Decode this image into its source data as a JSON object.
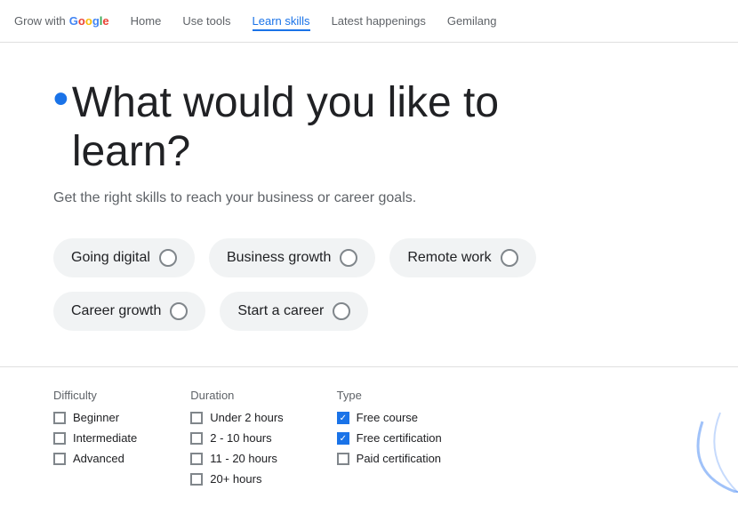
{
  "nav": {
    "logo_prefix": "Grow with ",
    "logo_text": "Google",
    "links": [
      {
        "id": "home",
        "label": "Home",
        "active": false
      },
      {
        "id": "use-tools",
        "label": "Use tools",
        "active": false
      },
      {
        "id": "learn-skills",
        "label": "Learn skills",
        "active": true
      },
      {
        "id": "latest-happenings",
        "label": "Latest happenings",
        "active": false
      },
      {
        "id": "gemilang",
        "label": "Gemilang",
        "active": false
      }
    ]
  },
  "hero": {
    "bullet": "•",
    "headline_line1": "What would you like to",
    "headline_line2": "learn?",
    "subtitle": "Get the right skills to reach your business or career goals."
  },
  "chips": [
    {
      "id": "going-digital",
      "label": "Going digital"
    },
    {
      "id": "business-growth",
      "label": "Business growth"
    },
    {
      "id": "remote-work",
      "label": "Remote work"
    },
    {
      "id": "career-growth",
      "label": "Career growth"
    },
    {
      "id": "start-a-career",
      "label": "Start a career"
    }
  ],
  "filters": {
    "difficulty": {
      "label": "Difficulty",
      "items": [
        {
          "id": "beginner",
          "label": "Beginner",
          "checked": false
        },
        {
          "id": "intermediate",
          "label": "Intermediate",
          "checked": false
        },
        {
          "id": "advanced",
          "label": "Advanced",
          "checked": false
        }
      ]
    },
    "duration": {
      "label": "Duration",
      "items": [
        {
          "id": "under-2h",
          "label": "Under 2 hours",
          "checked": false
        },
        {
          "id": "2-10h",
          "label": "2 - 10 hours",
          "checked": false
        },
        {
          "id": "11-20h",
          "label": "11 - 20 hours",
          "checked": false
        },
        {
          "id": "20plus",
          "label": "20+ hours",
          "checked": false
        }
      ]
    },
    "type": {
      "label": "Type",
      "items": [
        {
          "id": "free-course",
          "label": "Free course",
          "checked": true
        },
        {
          "id": "free-cert",
          "label": "Free certification",
          "checked": true
        },
        {
          "id": "paid-cert",
          "label": "Paid certification",
          "checked": false
        }
      ]
    }
  }
}
